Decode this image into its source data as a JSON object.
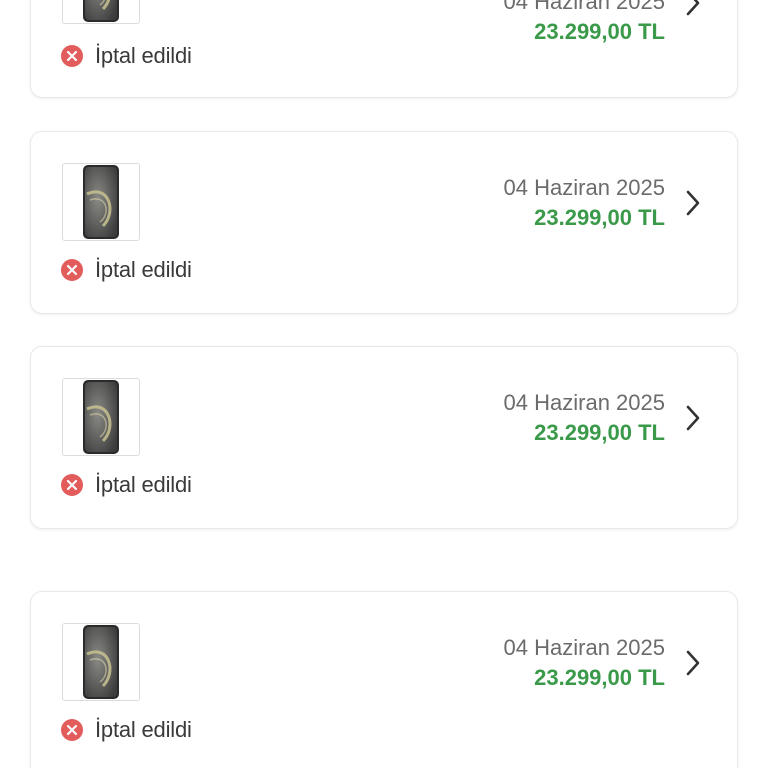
{
  "orders": [
    {
      "date": "04 Haziran 2025",
      "price": "23.299,00 TL",
      "status": "İptal edildi",
      "thumbnail_icon": "phone-thumbnail",
      "status_icon": "cancel-circle-icon"
    },
    {
      "date": "04 Haziran 2025",
      "price": "23.299,00 TL",
      "status": "İptal edildi",
      "thumbnail_icon": "phone-thumbnail",
      "status_icon": "cancel-circle-icon"
    },
    {
      "date": "04 Haziran 2025",
      "price": "23.299,00 TL",
      "status": "İptal edildi",
      "thumbnail_icon": "phone-thumbnail",
      "status_icon": "cancel-circle-icon"
    },
    {
      "date": "04 Haziran 2025",
      "price": "23.299,00 TL",
      "status": "İptal edildi",
      "thumbnail_icon": "phone-thumbnail",
      "status_icon": "cancel-circle-icon"
    }
  ],
  "colors": {
    "price": "#3a9a4a",
    "status_icon": "#e25c5c",
    "date": "#6b6b6b",
    "status_text": "#3a3a3a",
    "card_border": "#e8e8e8"
  }
}
